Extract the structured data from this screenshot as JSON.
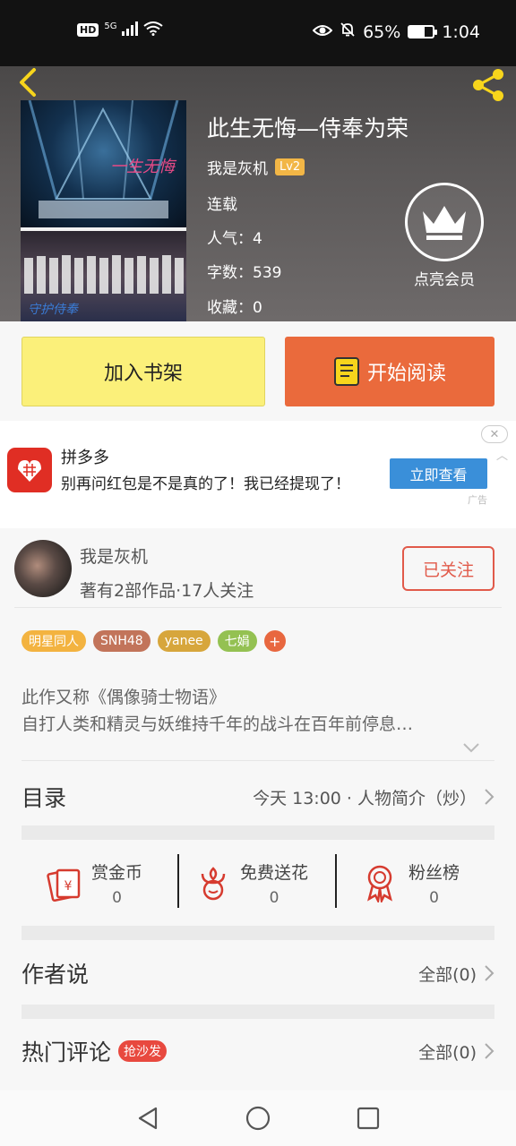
{
  "status_bar": {
    "hd": "HD",
    "network": "5G",
    "battery": "65%",
    "battery_level": 0.65,
    "time": "1:04"
  },
  "header": {
    "back_icon": "chevron-left-icon",
    "share_icon": "share-icon",
    "book_title": "此生无悔—侍奉为荣",
    "author": "我是灰机",
    "level": "Lv2",
    "status": "连载",
    "popularity": "人气：4",
    "word_count": "字数：539",
    "favorites": "收藏：0",
    "vip_label": "点亮会员",
    "accent": "#f7d51c"
  },
  "actions": {
    "add_shelf": "加入书架",
    "start_reading": "开始阅读"
  },
  "ad": {
    "app_name": "拼多多",
    "text": "别再问红包是不是真的了！我已经提现了！",
    "button": "立即查看",
    "close": "✕",
    "label": "广告"
  },
  "author_card": {
    "name": "我是灰机",
    "stats": "著有2部作品·17人关注",
    "follow": "已关注"
  },
  "tags": [
    {
      "label": "明星同人",
      "color": "#f3b340"
    },
    {
      "label": "SNH48",
      "color": "#c2745a"
    },
    {
      "label": "yanee",
      "color": "#d7a63c"
    },
    {
      "label": "七娟",
      "color": "#94c152"
    }
  ],
  "tag_add": "+",
  "intro": {
    "line1": "此作又称《偶像骑士物语》",
    "line2": "自打人类和精灵与妖维持千年的战斗在百年前停息…"
  },
  "catalog": {
    "title": "目录",
    "latest": "今天 13:00 · 人物简介（炒）"
  },
  "stats": [
    {
      "label": "赏金币",
      "value": "0",
      "icon": "reward-coin-icon"
    },
    {
      "label": "免费送花",
      "value": "0",
      "icon": "flower-icon"
    },
    {
      "label": "粉丝榜",
      "value": "0",
      "icon": "fan-ranking-icon"
    }
  ],
  "author_says": {
    "title": "作者说",
    "all": "全部(0)"
  },
  "comments": {
    "title": "热门评论",
    "badge": "抢沙发",
    "all": "全部(0)"
  }
}
